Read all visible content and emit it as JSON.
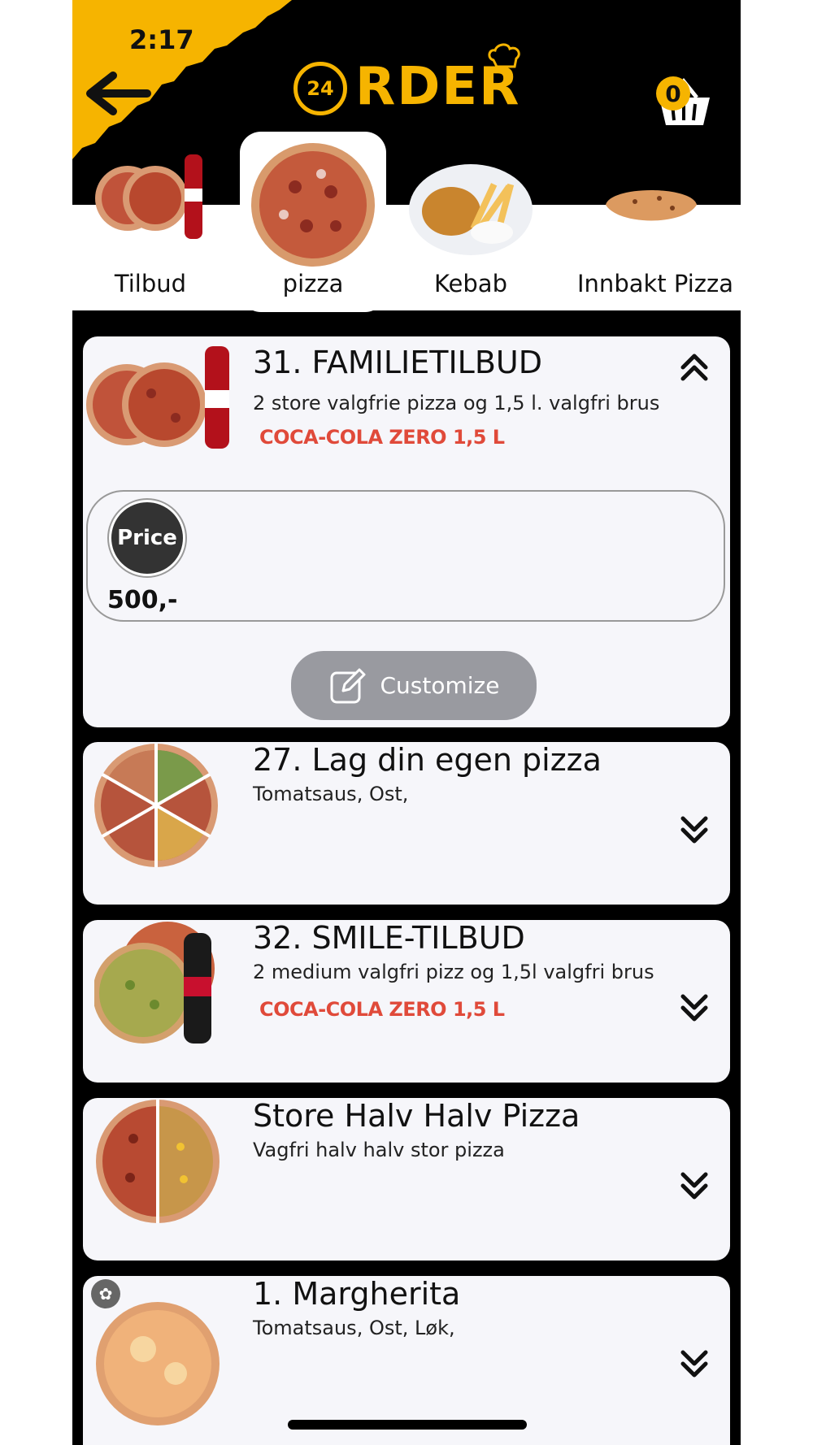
{
  "status": {
    "time": "2:17"
  },
  "header": {
    "logo_number": "24",
    "logo_text": "RDER",
    "cart_count": "0"
  },
  "categories": [
    {
      "label": "Tilbud",
      "active": false
    },
    {
      "label": "pizza",
      "active": true
    },
    {
      "label": "Kebab",
      "active": false
    },
    {
      "label": "Innbakt Pizza",
      "active": false
    }
  ],
  "items": [
    {
      "title": "31. FAMILIETILBUD",
      "description": "2 store valgfrie pizza og 1,5 l. valgfri brus",
      "drink": "COCA-COLA ZERO 1,5 L",
      "price_label": "Price",
      "price": "500,-",
      "customize_label": "Customize",
      "expanded": true
    },
    {
      "title": "27. Lag din egen pizza",
      "description": "Tomatsaus, Ost,",
      "expanded": false
    },
    {
      "title": "32. SMILE-TILBUD",
      "description": "2 medium valgfri pizz og 1,5l valgfri brus",
      "drink": "COCA-COLA ZERO 1,5 L",
      "expanded": false
    },
    {
      "title": "Store Halv Halv Pizza",
      "description": "Vagfri halv halv stor pizza",
      "expanded": false
    },
    {
      "title": "1. Margherita",
      "description": "Tomatsaus, Ost, Løk,",
      "expanded": false
    }
  ],
  "colors": {
    "accent": "#f6b400",
    "drink_red": "#e04a3a",
    "card_bg": "#f6f6fa",
    "customize_bg": "#999aa0"
  },
  "icons": [
    "back-arrow-icon",
    "cart-icon",
    "chevron-up-icon",
    "chevron-down-icon",
    "edit-icon",
    "vegetarian-icon"
  ]
}
